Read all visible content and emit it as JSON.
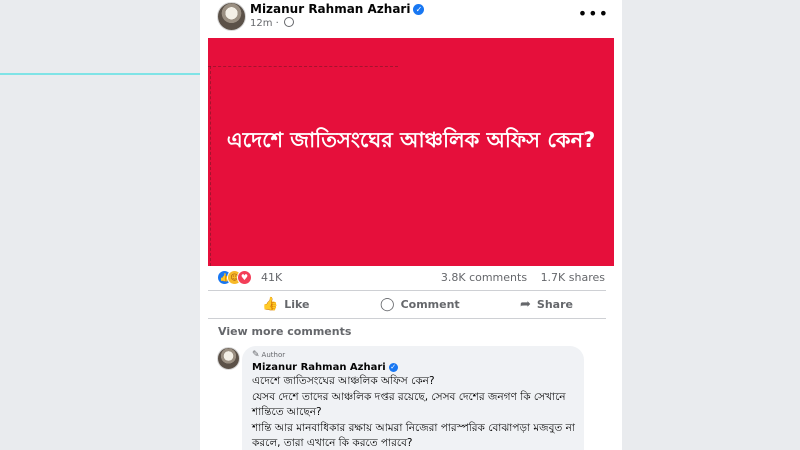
{
  "post": {
    "author": "Mizanur Rahman Azhari",
    "verified_glyph": "✓",
    "time": "12m",
    "more_glyph": "•••",
    "image_text": "এদেশে জাতিসংঘের আঞ্চলিক অফিস কেন?",
    "image_bg": "#e60f3b"
  },
  "stats": {
    "reactions_count": "41K",
    "reaction_icons": [
      "like-icon",
      "care-icon",
      "love-icon"
    ],
    "comments": "3.8K comments",
    "shares": "1.7K shares"
  },
  "actions": {
    "like": "Like",
    "comment": "Comment",
    "share": "Share"
  },
  "comments_section": {
    "view_more": "View more comments",
    "comment": {
      "badge": "Author",
      "author": "Mizanur Rahman Azhari",
      "lines": [
        "এদেশে জাতিসংঘের আঞ্চলিক অফিস কেন?",
        "যেসব দেশে তাদের আঞ্চলিক দপ্তর রয়েছে, সেসব দেশের জনগণ কি সেখানে শান্তিতে আছেন?",
        "শান্তি আর মানবাধিকার রক্ষায় আমরা নিজেরা পারস্পরিক বোঝাপড়া মজবুত না করলে, তারা এখানে কি করতে পারবে?"
      ]
    }
  }
}
